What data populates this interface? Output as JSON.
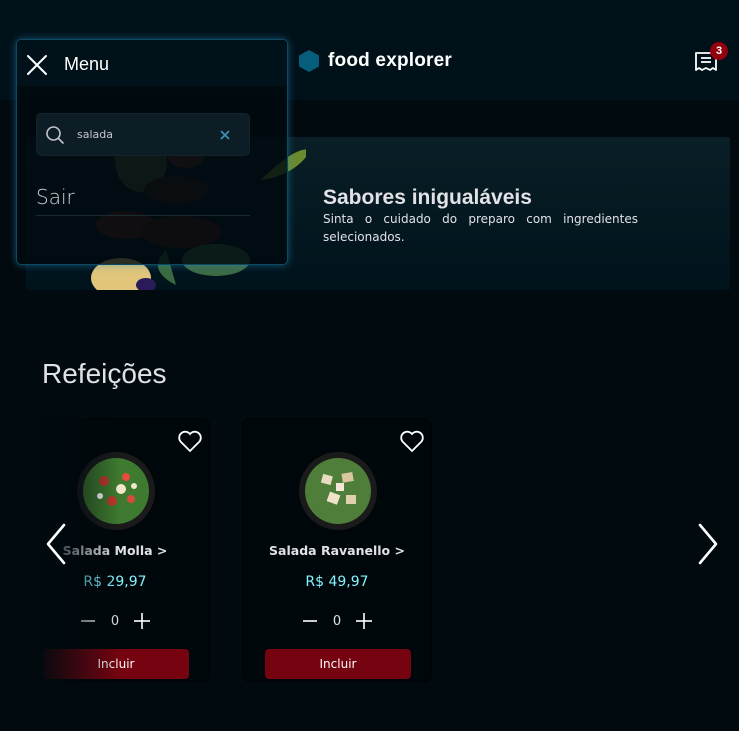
{
  "header": {
    "brand_name": "food explorer",
    "order_count": "3",
    "colors": {
      "brand_hex": "#065e7c",
      "badge": "#92000e"
    }
  },
  "banner": {
    "title": "Sabores inigualáveis",
    "subtitle": "Sinta o cuidado do preparo com ingredientes selecionados."
  },
  "section": {
    "title": "Refeições"
  },
  "dishes": [
    {
      "name": "Salada Molla >",
      "price": "R$ 29,97",
      "quantity": "0",
      "add_label": "Incluir"
    },
    {
      "name": "Salada Ravanello >",
      "price": "R$ 49,97",
      "quantity": "0",
      "add_label": "Incluir"
    }
  ],
  "menu": {
    "title": "Menu",
    "search": {
      "value": "salada",
      "placeholder": ""
    },
    "items": [
      {
        "label": "Sair"
      }
    ]
  },
  "icons": {
    "close": "close-icon",
    "search": "search-icon",
    "clear": "clear-icon",
    "receipt": "receipt-icon",
    "heart": "heart-icon",
    "minus": "minus-icon",
    "plus": "plus-icon",
    "chevron_left": "chevron-left-icon",
    "chevron_right": "chevron-right-icon"
  },
  "colors": {
    "background": "#000a0f",
    "accent_price": "#82f3ff",
    "button": "#750310",
    "menu_border": "#0b4a63"
  }
}
